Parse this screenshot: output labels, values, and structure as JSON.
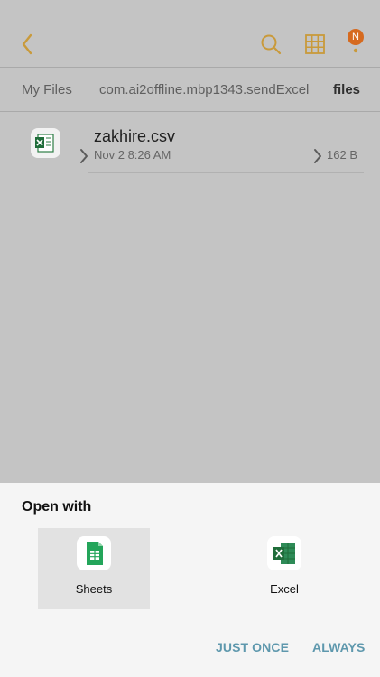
{
  "header": {
    "back_icon": "back-chevron-icon",
    "search_icon": "search-icon",
    "grid_icon": "grid-view-icon",
    "more_icon": "more-vertical-icon",
    "notification_badge": "N",
    "accent": "#c99a3b"
  },
  "breadcrumb": {
    "items": [
      "My Files",
      "com.ai2offline.mbp1343.sendExcel",
      "files"
    ]
  },
  "file": {
    "icon": "excel-file-icon",
    "name": "zakhire.csv",
    "date": "Nov 2 8:26 AM",
    "size": "162 B"
  },
  "sheet": {
    "title": "Open with",
    "apps": [
      {
        "label": "Sheets",
        "icon": "sheets-icon",
        "selected": true
      },
      {
        "label": "Excel",
        "icon": "excel-icon",
        "selected": false
      }
    ],
    "actions": [
      "JUST ONCE",
      "ALWAYS"
    ],
    "action_color": "#5e98ad"
  }
}
